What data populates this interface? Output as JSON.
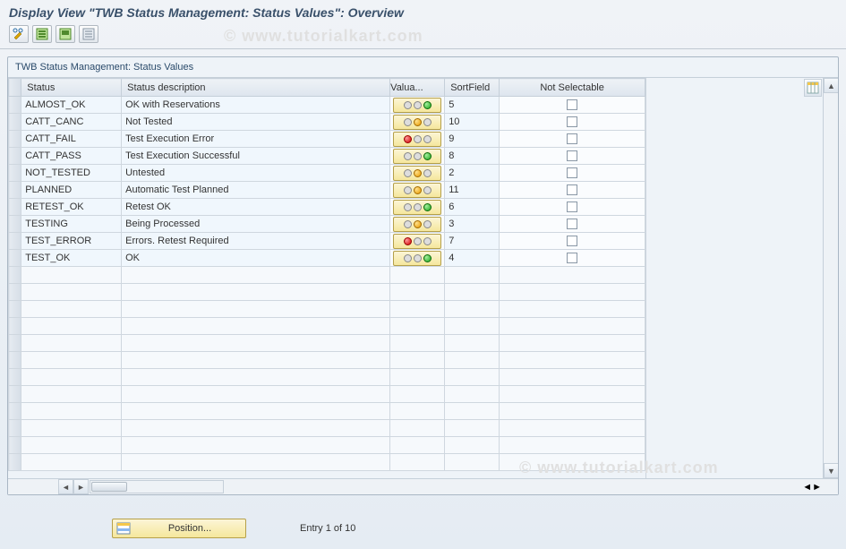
{
  "title": "Display View \"TWB Status Management: Status Values\": Overview",
  "watermark": "© www.tutorialkart.com",
  "panel_title": "TWB Status Management: Status Values",
  "columns": {
    "status": "Status",
    "desc": "Status description",
    "valua": "Valua...",
    "sort": "SortField",
    "notsel": "Not Selectable"
  },
  "rows": [
    {
      "status": "ALMOST_OK",
      "desc": "OK with Reservations",
      "light": "green",
      "sort": "5",
      "notsel": false
    },
    {
      "status": "CATT_CANC",
      "desc": "Not Tested",
      "light": "yellow",
      "sort": "10",
      "notsel": false
    },
    {
      "status": "CATT_FAIL",
      "desc": "Test Execution Error",
      "light": "red",
      "sort": "9",
      "notsel": false
    },
    {
      "status": "CATT_PASS",
      "desc": "Test Execution Successful",
      "light": "green",
      "sort": "8",
      "notsel": false
    },
    {
      "status": "NOT_TESTED",
      "desc": "Untested",
      "light": "yellow",
      "sort": "2",
      "notsel": false
    },
    {
      "status": "PLANNED",
      "desc": "Automatic Test Planned",
      "light": "yellow",
      "sort": "11",
      "notsel": false
    },
    {
      "status": "RETEST_OK",
      "desc": "Retest OK",
      "light": "green",
      "sort": "6",
      "notsel": false
    },
    {
      "status": "TESTING",
      "desc": "Being Processed",
      "light": "yellow",
      "sort": "3",
      "notsel": false
    },
    {
      "status": "TEST_ERROR",
      "desc": "Errors. Retest Required",
      "light": "red",
      "sort": "7",
      "notsel": false
    },
    {
      "status": "TEST_OK",
      "desc": "OK",
      "light": "green",
      "sort": "4",
      "notsel": false
    }
  ],
  "empty_rows": 12,
  "position_button": "Position...",
  "entry_text": "Entry 1 of 10"
}
